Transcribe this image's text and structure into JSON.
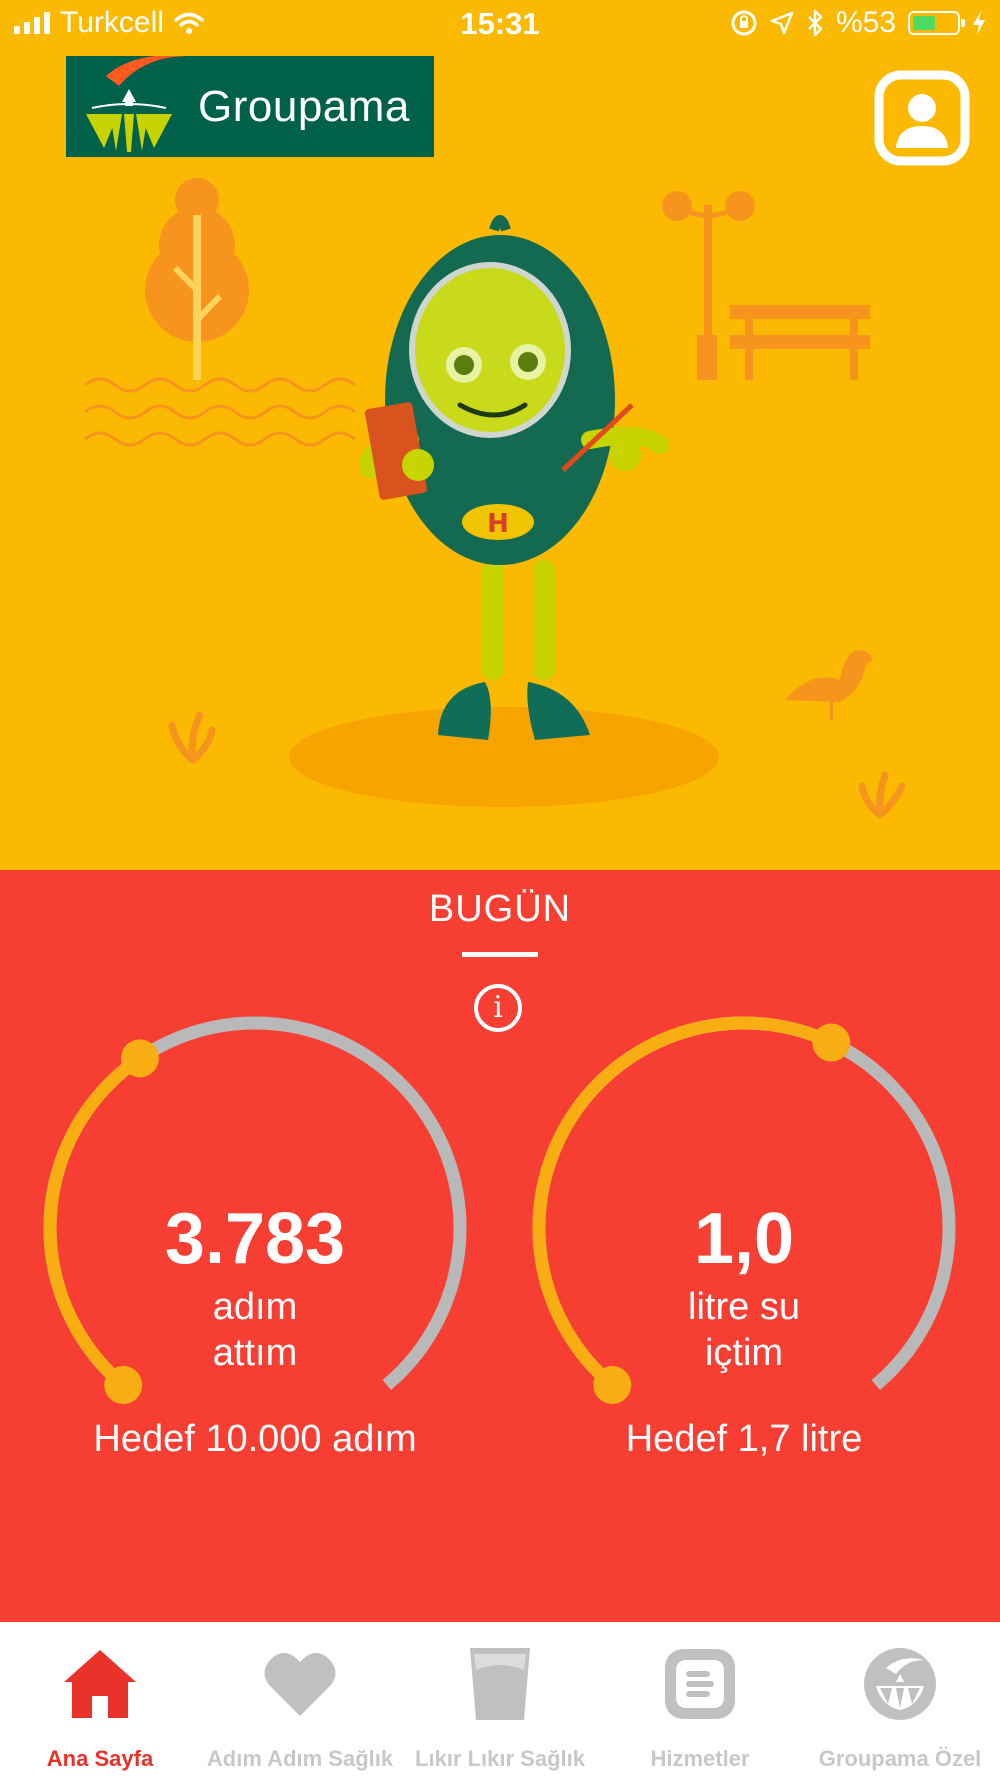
{
  "status_bar": {
    "carrier": "Turkcell",
    "time": "15:31",
    "battery": "%53",
    "battery_level": 0.53
  },
  "header": {
    "brand": "Groupama",
    "profile_icon": "profile-icon"
  },
  "colors": {
    "top_background": "#fbb901",
    "panel_background": "#f63e33",
    "gauge_progress": "#f8ad13",
    "gauge_track": "#b9b9b9",
    "brand_green": "#00614a",
    "active_tab": "#e8322a",
    "inactive_tab": "#c8c8c8"
  },
  "today": {
    "title": "BUGÜN",
    "info_icon": "info-icon"
  },
  "steps": {
    "value": "3.783",
    "label_line1": "adım",
    "label_line2": "attım",
    "goal": "Hedef 10.000 adım",
    "progress": 0.378
  },
  "water": {
    "value": "1,0",
    "label_line1": "litre su",
    "label_line2": "içtim",
    "goal": "Hedef 1,7 litre",
    "progress": 0.59
  },
  "tabs": [
    {
      "label": "Ana Sayfa",
      "icon": "home-icon",
      "active": true
    },
    {
      "label": "Adım Adım Sağlık",
      "icon": "heart-icon",
      "active": false
    },
    {
      "label": "Lıkır Lıkır Sağlık",
      "icon": "glass-icon",
      "active": false
    },
    {
      "label": "Hizmetler",
      "icon": "services-icon",
      "active": false
    },
    {
      "label": "Groupama Özel",
      "icon": "groupama-icon",
      "active": false
    }
  ]
}
